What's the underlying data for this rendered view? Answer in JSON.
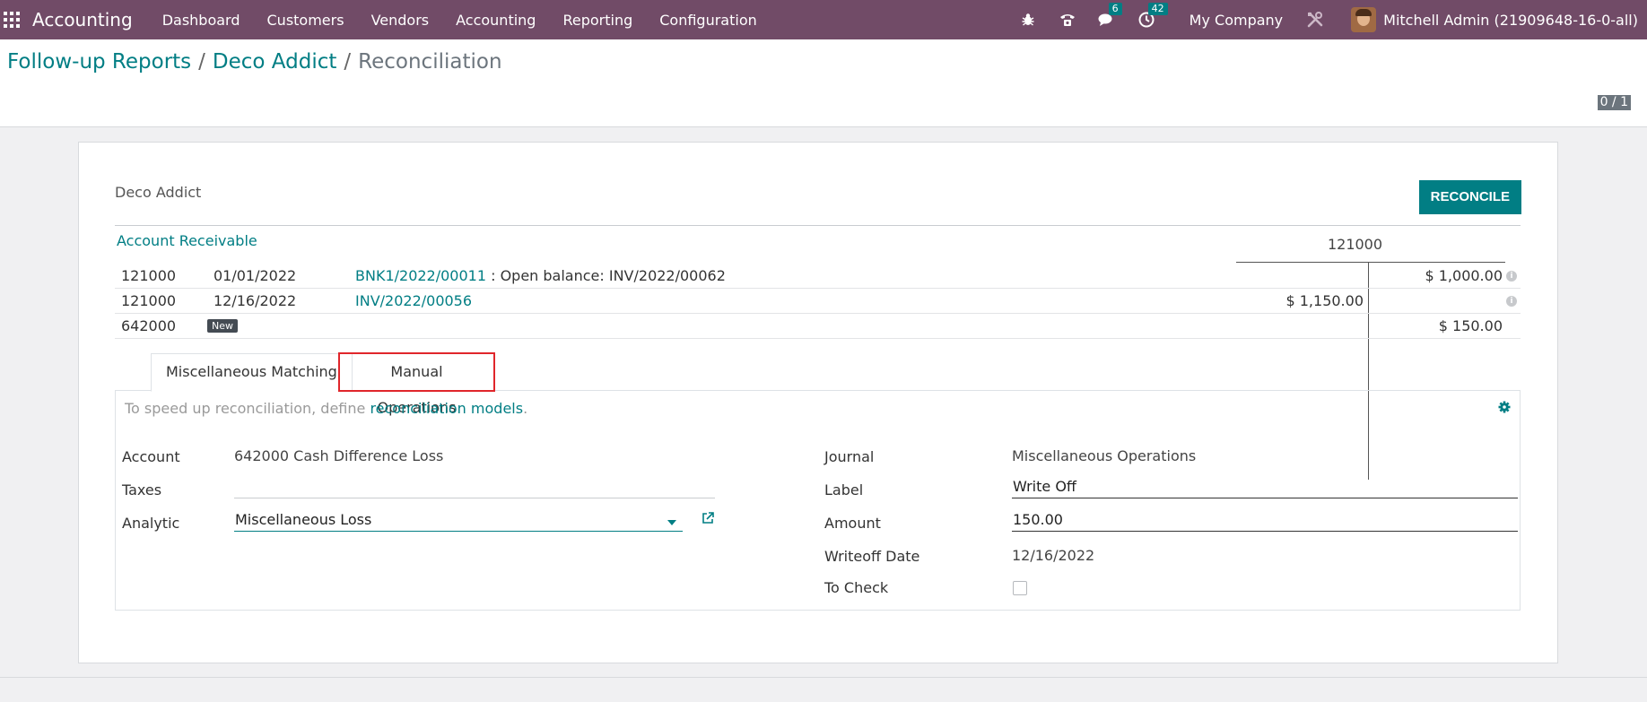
{
  "navbar": {
    "app_name": "Accounting",
    "menu": [
      "Dashboard",
      "Customers",
      "Vendors",
      "Accounting",
      "Reporting",
      "Configuration"
    ],
    "chat_badge": "6",
    "activity_badge": "42",
    "company": "My Company",
    "user": "Mitchell Admin (21909648-16-0-all)",
    "icons": [
      "apps-grid-icon",
      "bug-icon",
      "phone-icon",
      "chat-icon",
      "clock-icon",
      "tools-icon"
    ]
  },
  "breadcrumb": {
    "items": [
      "Follow-up Reports",
      "Deco Addict"
    ],
    "current": "Reconciliation",
    "separator": "/"
  },
  "pager": "0 / 1",
  "partner": "Deco Addict",
  "reconcile_button": "RECONCILE",
  "account_section": "Account Receivable",
  "account_column": "121000",
  "lines": [
    {
      "account": "121000",
      "date": "01/01/2022",
      "ref": "BNK1/2022/00011",
      "label": " : Open balance: INV/2022/00062",
      "debit": "",
      "credit": "$ 1,000.00"
    },
    {
      "account": "121000",
      "date": "12/16/2022",
      "ref": "INV/2022/00056",
      "label": "",
      "debit": "$ 1,150.00",
      "credit": ""
    },
    {
      "account": "642000",
      "badge": "New",
      "debit": "",
      "credit": "$ 150.00"
    }
  ],
  "tabs": [
    "Miscellaneous Matching",
    "Manual Operations"
  ],
  "active_tab": "Manual Operations",
  "hint": {
    "prefix": "To speed up reconciliation, define ",
    "link": "reconciliation models",
    "suffix": "."
  },
  "form": {
    "account_label": "Account",
    "account_value": "642000 Cash Difference Loss",
    "taxes_label": "Taxes",
    "taxes_value": "",
    "analytic_label": "Analytic",
    "analytic_value": "Miscellaneous Loss",
    "journal_label": "Journal",
    "journal_value": "Miscellaneous Operations",
    "label_label": "Label",
    "label_value": "Write Off",
    "amount_label": "Amount",
    "amount_value": "150.00",
    "writeoff_date_label": "Writeoff Date",
    "writeoff_date_value": "12/16/2022",
    "to_check_label": "To Check",
    "to_check": false
  },
  "colors": {
    "brand": "#714b67",
    "accent": "#017e84",
    "highlight": "#e0262b"
  }
}
